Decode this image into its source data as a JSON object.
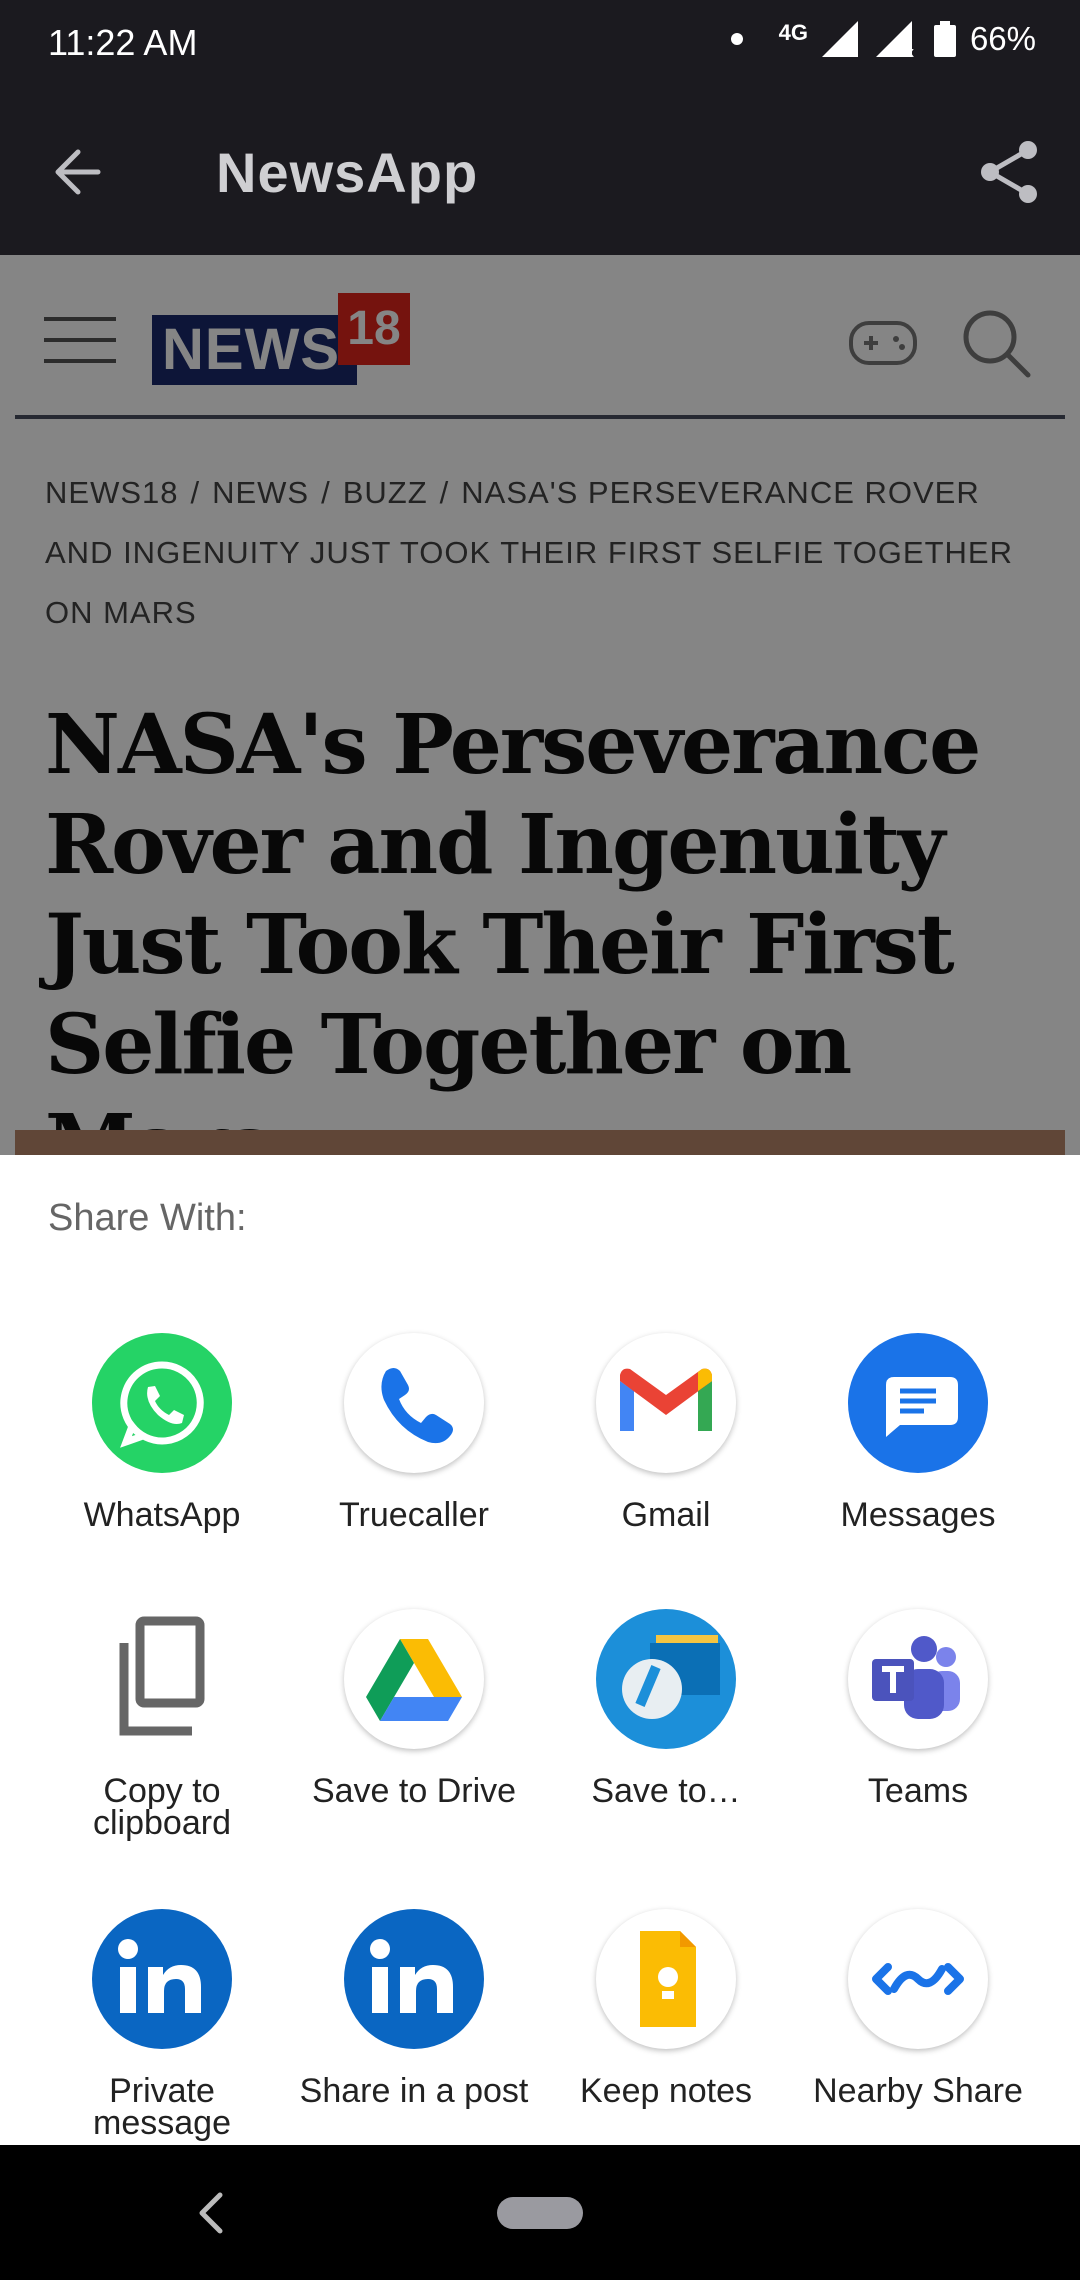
{
  "status_bar": {
    "time": "11:22 AM",
    "network": "4G",
    "battery": "66%"
  },
  "app_bar": {
    "title": "NewsApp",
    "back_icon": "arrow-left-icon",
    "share_icon": "share-icon"
  },
  "site": {
    "logo_text": "NEWS",
    "logo_number": "18",
    "breadcrumb": [
      "NEWS18",
      "NEWS",
      "BUZZ",
      "NASA'S PERSEVERANCE ROVER AND INGENUITY JUST TOOK THEIR FIRST SELFIE TOGETHER ON MARS"
    ],
    "breadcrumb_separator": "/",
    "headline": "NASA's Perseverance Rover and Ingenuity Just Took Their First Selfie Together on Mars"
  },
  "share_sheet": {
    "title": "Share With:",
    "targets": [
      {
        "label": "WhatsApp",
        "icon": "whatsapp-icon"
      },
      {
        "label": "Truecaller",
        "icon": "truecaller-icon"
      },
      {
        "label": "Gmail",
        "icon": "gmail-icon"
      },
      {
        "label": "Messages",
        "icon": "messages-icon"
      },
      {
        "label": "Copy to clipboard",
        "icon": "copy-icon"
      },
      {
        "label": "Save to Drive",
        "icon": "google-drive-icon"
      },
      {
        "label": "Save to…",
        "icon": "files-icon"
      },
      {
        "label": "Teams",
        "icon": "teams-icon"
      },
      {
        "label": "Private message",
        "icon": "linkedin-icon"
      },
      {
        "label": "Share in a post",
        "icon": "linkedin-icon"
      },
      {
        "label": "Keep notes",
        "icon": "keep-notes-icon"
      },
      {
        "label": "Nearby Share",
        "icon": "nearby-share-icon"
      }
    ]
  },
  "colors": {
    "status_bar_bg": "#1b1a1f",
    "whatsapp": "#25d366",
    "linkedin": "#0a66c2",
    "messages": "#1a73e8",
    "logo_blue": "#1a2a6c",
    "logo_red": "#e1251b"
  }
}
